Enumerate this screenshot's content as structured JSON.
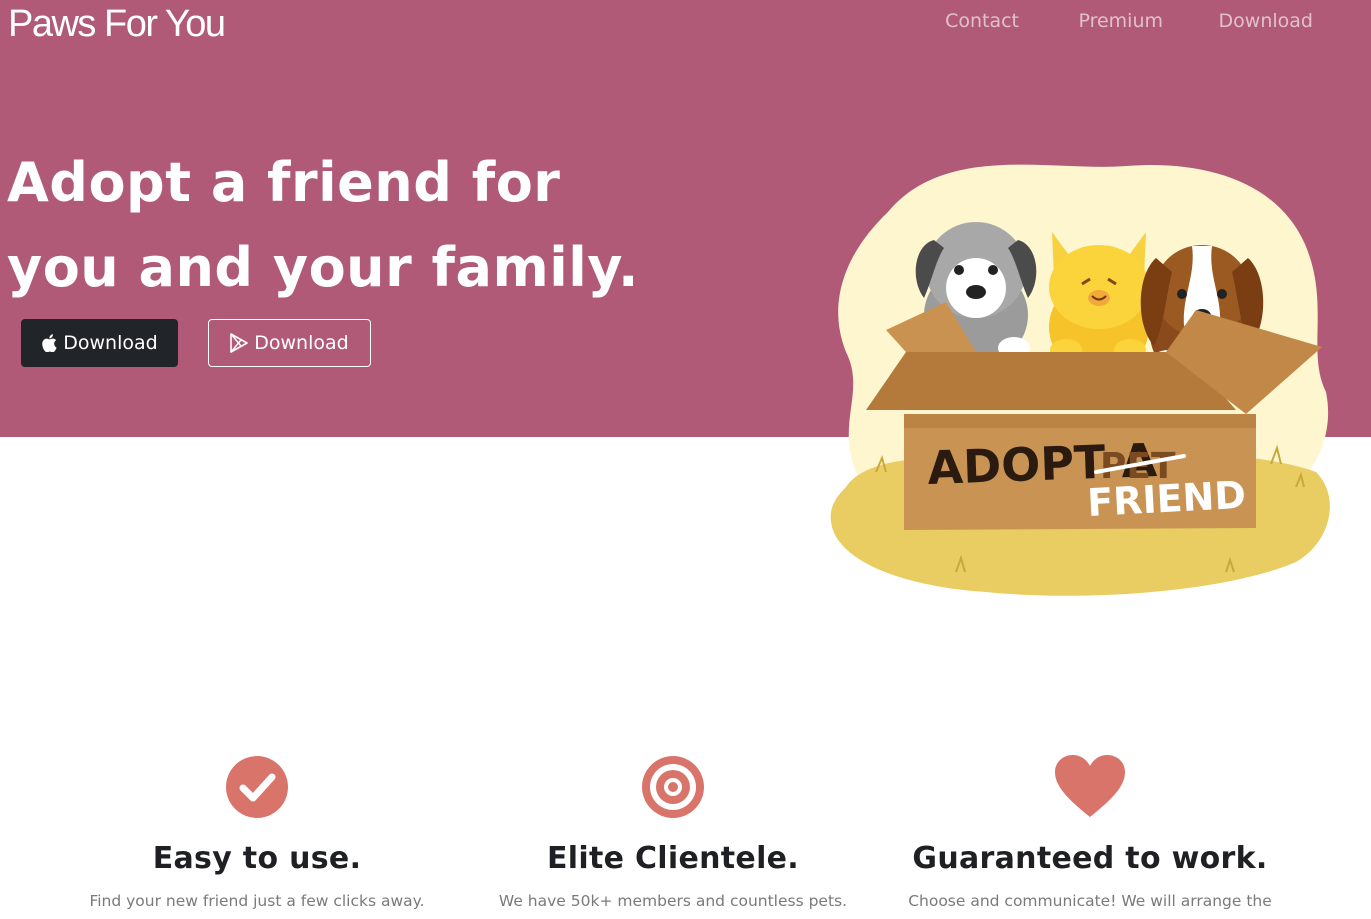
{
  "brand": {
    "name": "Paws For You"
  },
  "nav": {
    "items": [
      "Contact",
      "Premium",
      "Download"
    ]
  },
  "hero": {
    "headline_line1": "Adopt a friend for",
    "headline_line2": "you and your family.",
    "apple_button_label": "Download",
    "play_button_label": "Download",
    "illustration": {
      "box_text": "ADOPT A",
      "crossed_word": "PET",
      "replacement_word": "FRIEND"
    }
  },
  "features": [
    {
      "icon": "check-circle-icon",
      "title": "Easy to use.",
      "desc": "Find your new friend just a few clicks away."
    },
    {
      "icon": "target-icon",
      "title": "Elite Clientele.",
      "desc": "We have 50k+ members and countless pets."
    },
    {
      "icon": "heart-icon",
      "title": "Guaranteed to work.",
      "desc": "Choose and communicate! We will arrange the"
    }
  ],
  "colors": {
    "hero_bg": "#b05a78",
    "accent": "#d9746b",
    "dark_button": "#212429"
  }
}
